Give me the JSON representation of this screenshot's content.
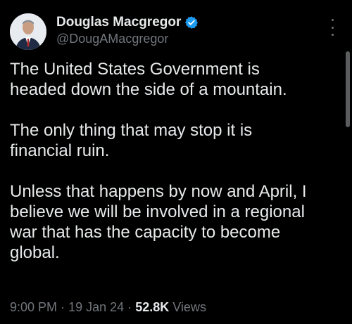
{
  "author": {
    "name": "Douglas Macgregor",
    "handle": "@DougAMacgregor",
    "verified_color": "#1d9bf0"
  },
  "tweet": {
    "paragraphs": [
      "The United States Government is\nheaded down the side of a mountain.",
      "The only thing that may stop it is\nfinancial ruin.",
      "Unless that happens by now and April, I\nbelieve we will be involved in a regional\nwar that has the capacity to become\nglobal."
    ]
  },
  "meta": {
    "time": "9:00 PM",
    "separator": "·",
    "date": "19 Jan 24",
    "views_count": "52.8K",
    "views_label": "Views"
  }
}
